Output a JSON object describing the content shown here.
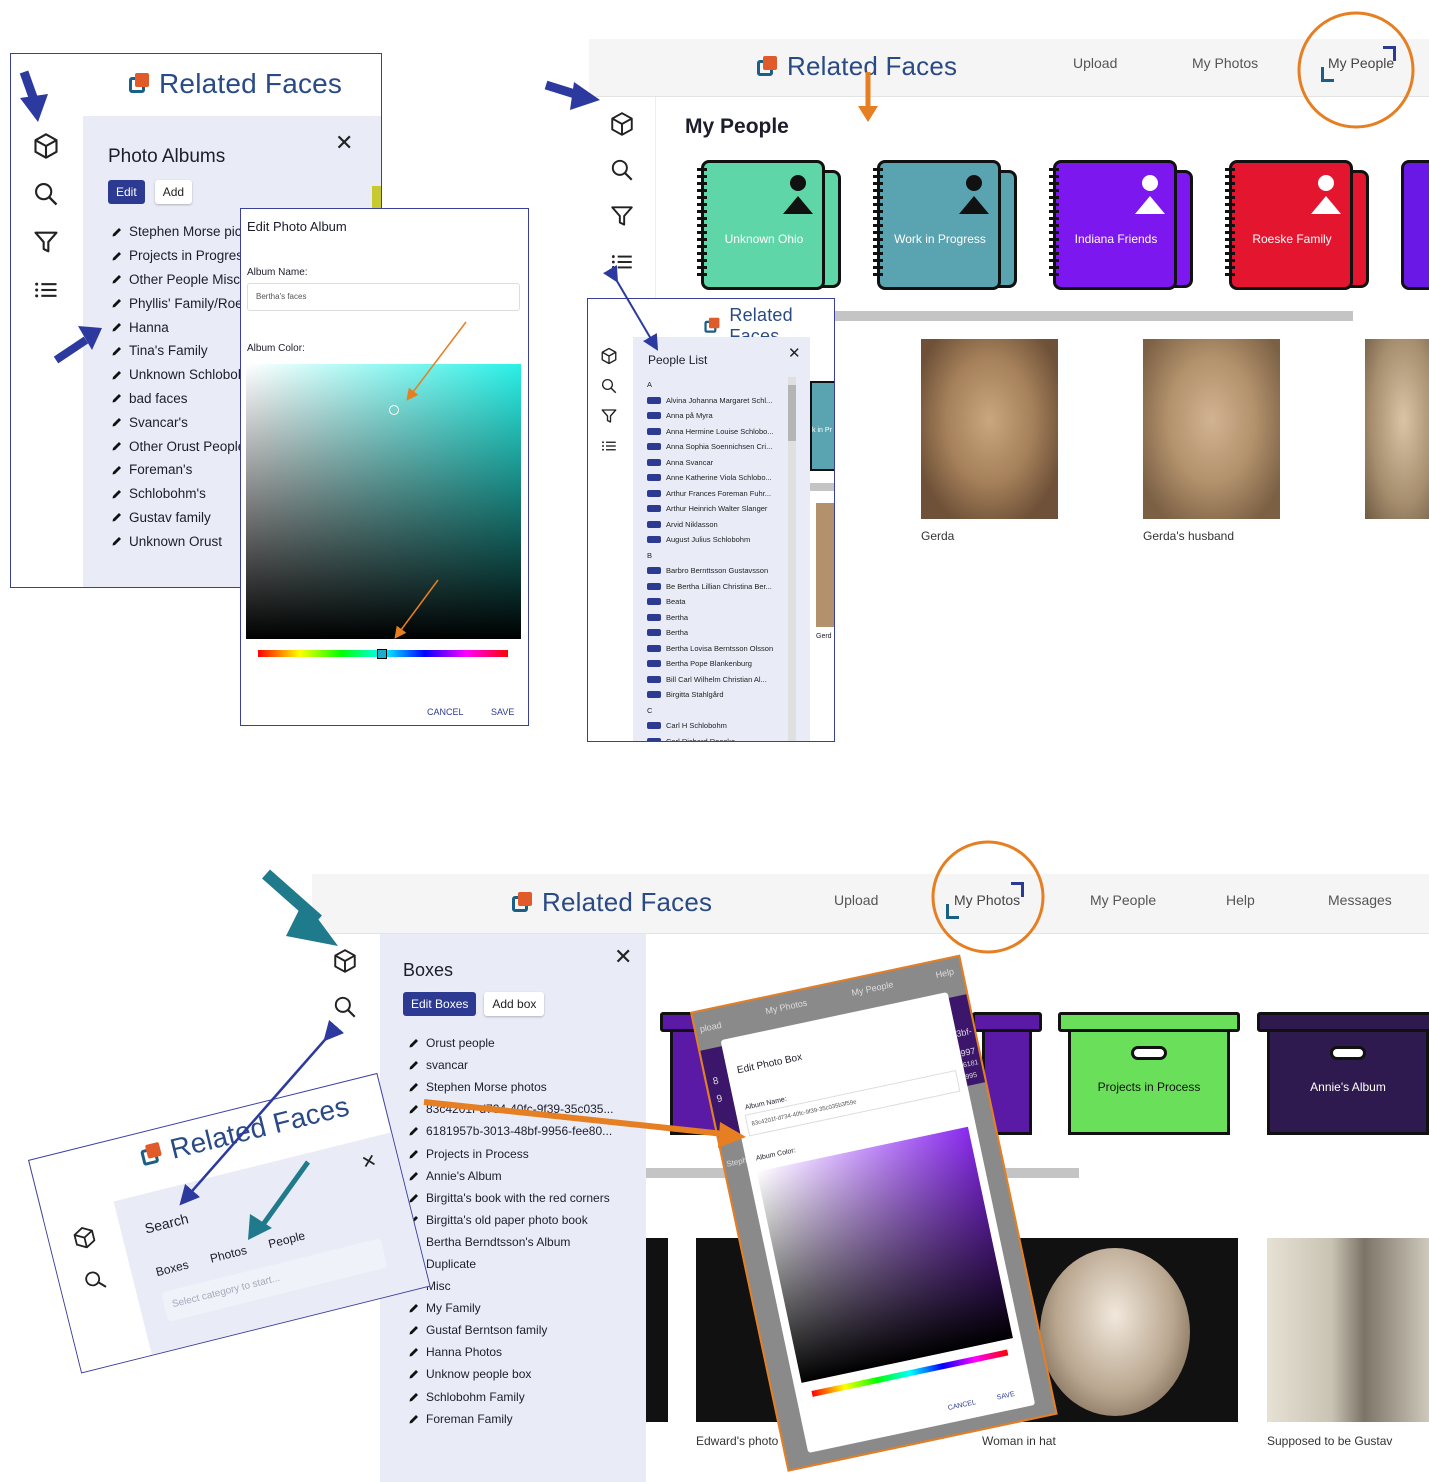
{
  "brand": "Related Faces",
  "panel1": {
    "title": "Photo Albums",
    "edit": "Edit",
    "add": "Add",
    "albums": [
      "Stephen Morse pict",
      "Projects in Progress",
      "Other People Misc",
      "Phyllis' Family/Roes",
      "Hanna",
      "Tina's Family",
      "Unknown Schlobol",
      "bad faces",
      "Svancar's",
      "Other Orust People",
      "Foreman's",
      "Schlobohm's",
      "Gustav family",
      "Unknown Orust"
    ]
  },
  "edit_album_dialog": {
    "title": "Edit Photo Album",
    "name_label": "Album Name:",
    "name_value": "Bertha's faces",
    "color_label": "Album Color:",
    "cancel": "CANCEL",
    "save": "SAVE"
  },
  "top_right_nav": {
    "upload": "Upload",
    "my_photos": "My Photos",
    "my_people": "My People"
  },
  "my_people": {
    "title": "My People",
    "albums": [
      {
        "label": "Unknown Ohio",
        "color": "#5ed6a7"
      },
      {
        "label": "Work in Progress",
        "color": "#5aa3b0"
      },
      {
        "label": "Indiana Friends",
        "color": "#7d17f0"
      },
      {
        "label": "Roeske Family",
        "color": "#e4162f"
      }
    ],
    "faces": [
      {
        "caption": "Gerda"
      },
      {
        "caption": "Gerda's husband"
      }
    ]
  },
  "people_list": {
    "title": "People List",
    "groups": [
      {
        "letter": "A",
        "names": [
          "Alvina Johanna Margaret Schl...",
          "Anna på Myra",
          "Anna Hermine Louise Schlobo...",
          "Anna Sophia Soennichsen Cri...",
          "Anna Svancar",
          "Anne Katherine Viola Schlobo...",
          "Arthur Frances Foreman Fuhr...",
          "Arthur Heinrich Walter Slanger",
          "Arvid Niklasson",
          "August Julius Schlobohm"
        ]
      },
      {
        "letter": "B",
        "names": [
          "Barbro Bernttsson Gustavsson",
          "Be Bertha Lillian Christina Ber...",
          "Beata",
          "Bertha",
          "Bertha",
          "Bertha Lovisa Berntsson Olsson",
          "Bertha Pope Blankenburg",
          "Bill Carl Wilhelm Christian Al...",
          "Birgitta Stahlgård"
        ]
      },
      {
        "letter": "C",
        "names": [
          "Carl H Schlobohm",
          "Carl Richard Roeske"
        ]
      }
    ],
    "behind_text": "k in Pr",
    "behind_caption": "Gerd"
  },
  "bottom_nav": {
    "upload": "Upload",
    "my_photos": "My Photos",
    "my_people": "My People",
    "help": "Help",
    "messages": "Messages"
  },
  "boxes": {
    "title": "Boxes",
    "edit": "Edit Boxes",
    "add": "Add box",
    "items": [
      "Orust people",
      "svancar",
      "Stephen Morse photos",
      "83c4201f-d734-40fc-9f39-35c035...",
      "6181957b-3013-48bf-9956-fee80...",
      "Projects in Process",
      "Annie's Album",
      "Birgitta's book with the red corners",
      "Birgitta's old paper photo book",
      "Bertha Berndtsson's Album",
      "Duplicate",
      "Misc",
      "My Family",
      "Gustaf Berntson family",
      "Hanna Photos",
      "Unknow people box",
      "Schlobohm Family",
      "Foreman Family"
    ]
  },
  "photo_boxes": [
    {
      "label": "Projects in Process",
      "color": "#6ae05a"
    },
    {
      "label": "Annie's Album",
      "color": "#2e1a4e"
    }
  ],
  "photos_captions": [
    "Edward's photo",
    "Woman in hat",
    "Supposed to be Gustav"
  ],
  "search_panel": {
    "title": "Search",
    "tabs": [
      "Boxes",
      "Photos",
      "People"
    ],
    "placeholder": "Select category to start..."
  },
  "edit_box_dialog": {
    "nav": [
      "pload",
      "My Photos",
      "My People",
      "Help"
    ],
    "title": "Edit Photo Box",
    "name_label": "Album Name:",
    "name_value": "83c4201f-d734-40fc-9f39-35c035b3f59e",
    "color_label": "Album Color:",
    "cancel": "CANCEL",
    "save": "SAVE",
    "behind_left": "Stephe",
    "behind_right_1": "3bf-",
    "behind_right_2": "997",
    "behind_right_3": "6181",
    "behind_right_4": "995",
    "behind_box_1": "8",
    "behind_box_2": "9"
  },
  "colors": {
    "accent_blue": "#2c3a91",
    "arrow_blue": "#2c3aa0",
    "arrow_teal": "#1f7a8c",
    "arrow_orange": "#e67e22",
    "panel": "#e9ecf7"
  },
  "icons": [
    "cube-icon",
    "search-icon",
    "filter-icon",
    "list-icon",
    "pencil-icon",
    "close-icon"
  ]
}
